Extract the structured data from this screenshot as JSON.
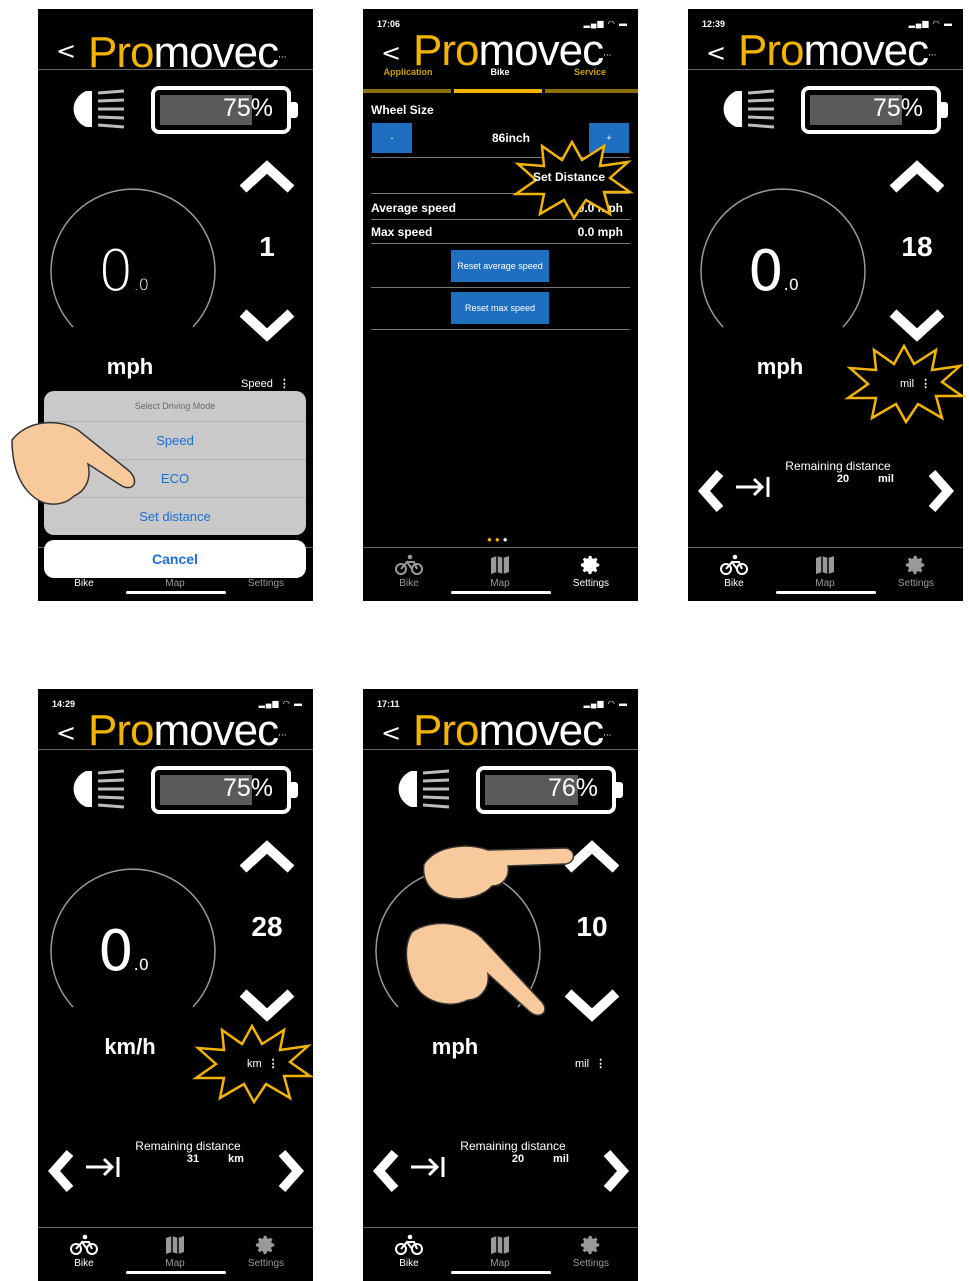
{
  "app": {
    "logo_prefix": "Pro",
    "logo_o": "m",
    "logo_suffix": "ovec",
    "logo_dots": "...",
    "back": "<"
  },
  "nav": {
    "bike": "Bike",
    "map": "Map",
    "settings": "Settings"
  },
  "screen1": {
    "battery": "75%",
    "battery_level": 0.75,
    "level": "1",
    "speed_big": "0",
    "speed_dec": ".0",
    "unit": "mph",
    "mode_label": "Speed",
    "mode_menu": "⋮",
    "sheet_title": "Select Driving Mode",
    "options": [
      "Speed",
      "ECO",
      "Set distance"
    ],
    "cancel": "Cancel"
  },
  "screen2": {
    "time": "17:06",
    "tabs": [
      "Application",
      "Bike",
      "Service"
    ],
    "wheel_label": "Wheel Size",
    "minus": "-",
    "plus": "+",
    "wheel_value": "86inch",
    "set_distance": "Set Distance",
    "avg_label": "Average speed",
    "avg_value": "0.0 mph",
    "max_label": "Max speed",
    "max_value": "0.0 mph",
    "reset_avg": "Reset average speed",
    "reset_max": "Reset max speed"
  },
  "screen3": {
    "time": "12:39",
    "battery": "75%",
    "battery_level": 0.75,
    "level": "18",
    "speed_big": "0",
    "speed_dec": ".0",
    "unit": "mph",
    "mode_label": "mil",
    "mode_menu": "⋮",
    "remaining_label": "Remaining distance",
    "remaining_value": "20",
    "remaining_unit": "mil"
  },
  "screen4": {
    "time": "14:29",
    "battery": "75%",
    "battery_level": 0.75,
    "level": "28",
    "speed_big": "0",
    "speed_dec": ".0",
    "unit": "km/h",
    "mode_label": "km",
    "mode_menu": "⋮",
    "remaining_label": "Remaining distance",
    "remaining_value": "31",
    "remaining_unit": "km"
  },
  "screen5": {
    "time": "17:11",
    "battery": "76%",
    "battery_level": 0.76,
    "level": "10",
    "speed_big": "0",
    "speed_dec": ".0",
    "unit": "mph",
    "mode_label": "mil",
    "mode_menu": "⋮",
    "remaining_label": "Remaining distance",
    "remaining_value": "20",
    "remaining_unit": "mil"
  },
  "colors": {
    "brand_yellow": "#f2b400",
    "button_blue": "#1f6fc0",
    "link_blue": "#1a6fe0",
    "burst": "#f2b400"
  }
}
